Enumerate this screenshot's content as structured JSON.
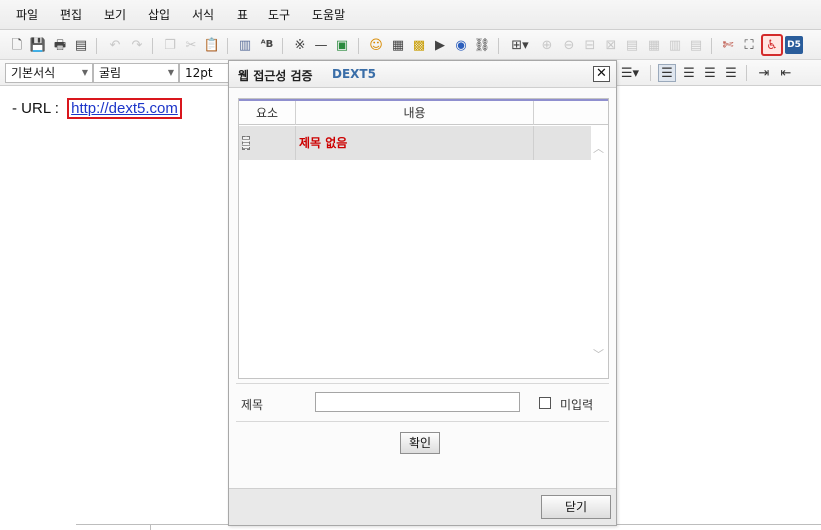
{
  "menu": [
    "파일",
    "편집",
    "보기",
    "삽입",
    "서식",
    "표",
    "도구",
    "도움말"
  ],
  "toolbar2": {
    "style_value": "기본서식",
    "font_value": "굴림",
    "size_value": "12pt"
  },
  "document": {
    "url_prefix": "- URL : ",
    "url_link": "http://dext5.com"
  },
  "dialog": {
    "title": "웹 접근성 검증",
    "brand": "DEXT5",
    "close_glyph": "✕",
    "columns": [
      "요소",
      "내용"
    ],
    "rows": [
      {
        "element": "",
        "content": "제목 없음"
      }
    ],
    "title_label": "제목",
    "title_value": "",
    "no_input_label": "미입력",
    "confirm_label": "확인",
    "close_label": "닫기"
  },
  "colors": {
    "error_text": "#cc0000",
    "link": "#1c35c9",
    "highlight_border": "#d9161d",
    "brand": "#3a6ea8"
  },
  "icons": {
    "toolbar1": [
      "new-document-icon",
      "save-icon",
      "print-icon",
      "print-preview-icon",
      "undo-icon",
      "redo-icon",
      "copy-icon",
      "cut-icon",
      "paste-icon",
      "paste-text-icon",
      "spellcheck-icon",
      "special-char-icon",
      "horizontal-line-icon",
      "image-gallery-icon",
      "emoticon-icon",
      "background-icon",
      "image-icon",
      "media-icon",
      "flash-icon",
      "link-icon",
      "table-icon",
      "insert-row-icon",
      "delete-row-icon",
      "merge-cell-icon",
      "split-cell-icon",
      "cell-props-icon",
      "table-props-icon",
      "col-icon",
      "row-icon",
      "tools-icon",
      "fullscreen-icon",
      "accessibility-icon",
      "dext5-icon"
    ]
  }
}
